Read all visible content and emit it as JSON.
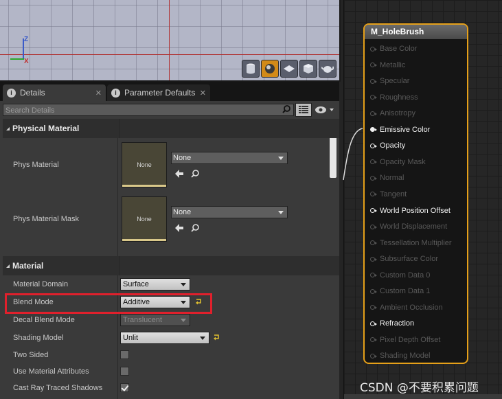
{
  "tabs": [
    {
      "label": "Details"
    },
    {
      "label": "Parameter Defaults"
    }
  ],
  "search": {
    "placeholder": "Search Details"
  },
  "categories": {
    "physical_material": "Physical Material",
    "material": "Material"
  },
  "physical_material": {
    "phys_material_label": "Phys Material",
    "phys_material_value": "None",
    "phys_material_thumb": "None",
    "phys_material_mask_label": "Phys Material Mask",
    "phys_material_mask_value": "None",
    "phys_material_mask_thumb": "None"
  },
  "material": {
    "domain_label": "Material Domain",
    "domain_value": "Surface",
    "blend_mode_label": "Blend Mode",
    "blend_mode_value": "Additive",
    "decal_blend_label": "Decal Blend Mode",
    "decal_blend_value": "Translucent",
    "shading_model_label": "Shading Model",
    "shading_model_value": "Unlit",
    "two_sided_label": "Two Sided",
    "two_sided_checked": false,
    "use_material_attributes_label": "Use Material Attributes",
    "use_material_attributes_checked": false,
    "cast_ray_traced_shadows_label": "Cast Ray Traced Shadows",
    "cast_ray_traced_shadows_checked": true
  },
  "node": {
    "title": "M_HoleBrush",
    "pins": [
      {
        "label": "Base Color",
        "active": false
      },
      {
        "label": "Metallic",
        "active": false
      },
      {
        "label": "Specular",
        "active": false
      },
      {
        "label": "Roughness",
        "active": false
      },
      {
        "label": "Anisotropy",
        "active": false
      },
      {
        "label": "Emissive Color",
        "active": true,
        "connected": true
      },
      {
        "label": "Opacity",
        "active": true
      },
      {
        "label": "Opacity Mask",
        "active": false
      },
      {
        "label": "Normal",
        "active": false
      },
      {
        "label": "Tangent",
        "active": false
      },
      {
        "label": "World Position Offset",
        "active": true
      },
      {
        "label": "World Displacement",
        "active": false
      },
      {
        "label": "Tessellation Multiplier",
        "active": false
      },
      {
        "label": "Subsurface Color",
        "active": false
      },
      {
        "label": "Custom Data 0",
        "active": false
      },
      {
        "label": "Custom Data 1",
        "active": false
      },
      {
        "label": "Ambient Occlusion",
        "active": false
      },
      {
        "label": "Refraction",
        "active": true
      },
      {
        "label": "Pixel Depth Offset",
        "active": false
      },
      {
        "label": "Shading Model",
        "active": false
      }
    ]
  },
  "viewport": {
    "axis_z": "Z",
    "axis_x": "X",
    "preview_buttons": [
      "cylinder-icon",
      "sphere-icon",
      "plane-icon",
      "cube-icon",
      "teapot-icon"
    ],
    "active_preview": "sphere-icon"
  },
  "colors": {
    "highlight": "#e0202c",
    "node_border": "#e6a019"
  },
  "watermark": "CSDN @不要积累问题"
}
